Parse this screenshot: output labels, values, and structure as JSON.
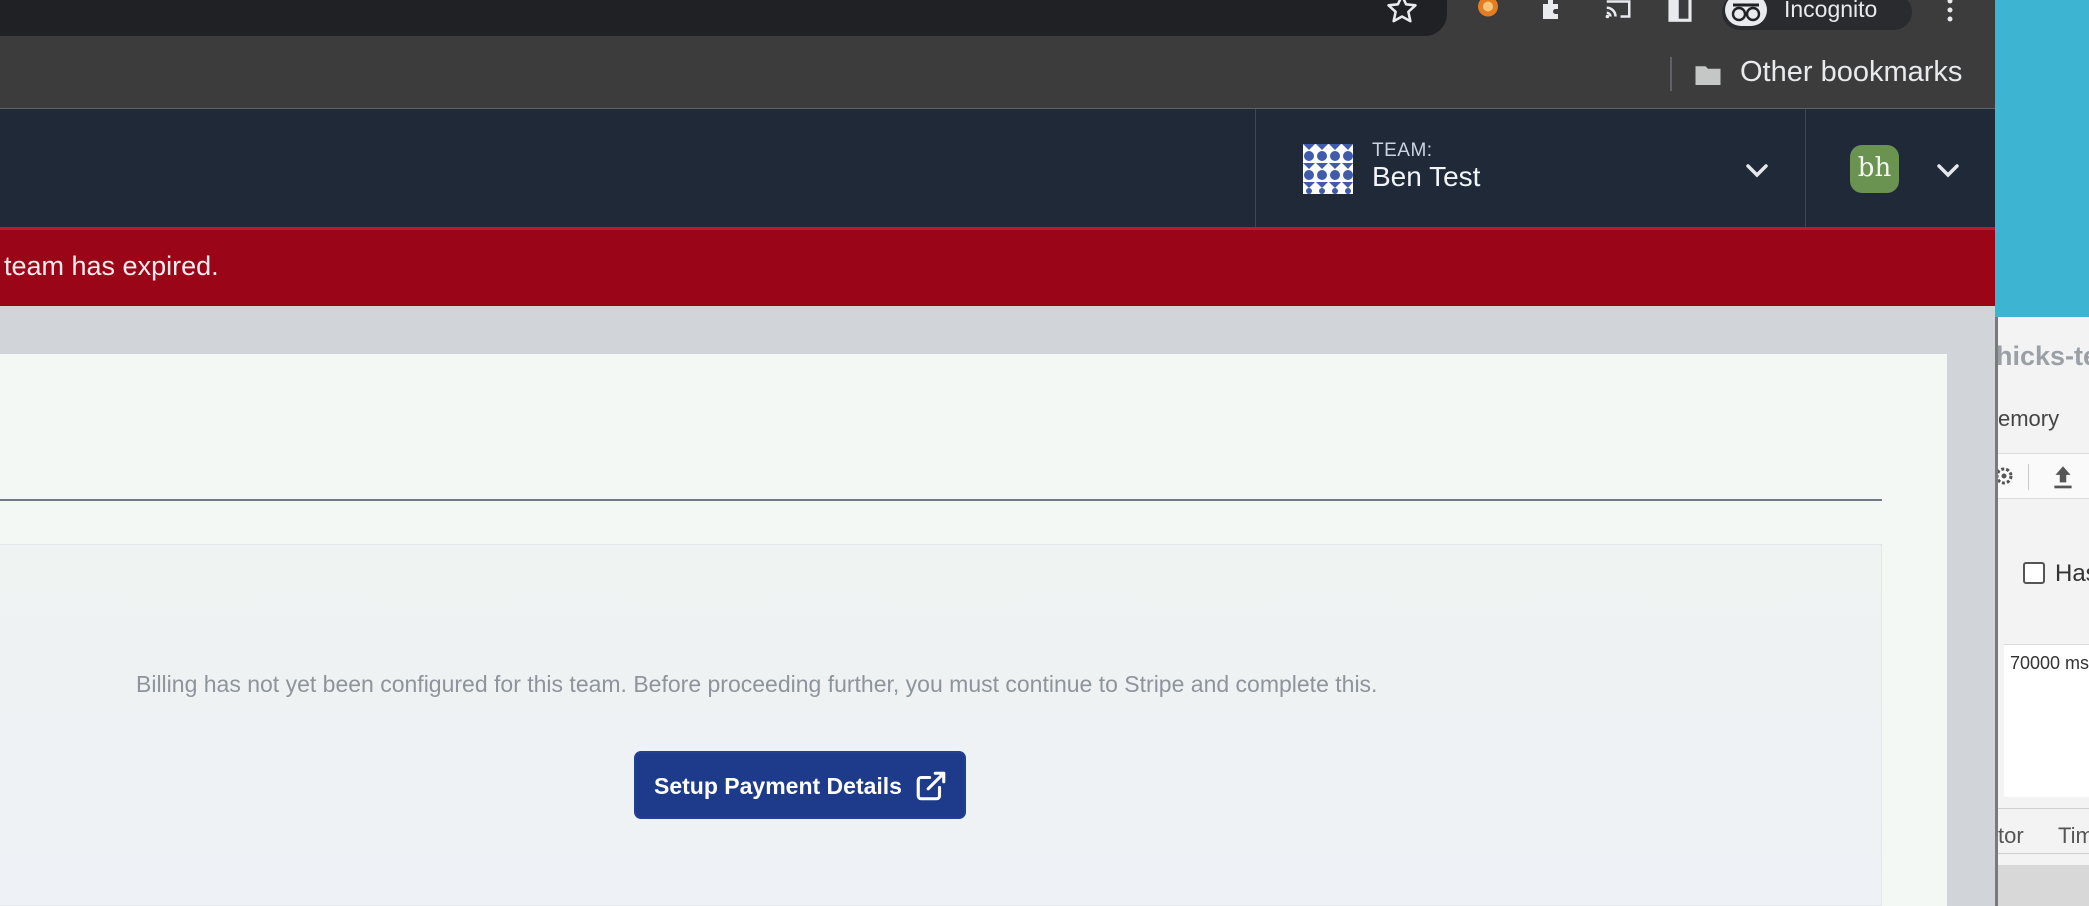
{
  "browser": {
    "profile_label": "Incognito",
    "bookmarks_folder": "Other bookmarks"
  },
  "header": {
    "team_label": "TEAM:",
    "team_name": "Ben Test",
    "user_initials": "bh"
  },
  "banner": {
    "message": "team has expired."
  },
  "billing": {
    "message": "Billing has not yet been configured for this team. Before proceeding further, you must continue to Stripe and complete this.",
    "button_label": "Setup Payment Details"
  },
  "background_window": {
    "title": "hicks-te",
    "memory_tab": "emory",
    "checkbox_label": "Has",
    "timeout_value": "70000 ms",
    "tab_left": "tor",
    "tab_right": "Tim"
  },
  "colors": {
    "header_bg": "#1f2937",
    "banner_bg": "#9a0617",
    "button_bg": "#1e3a8a",
    "avatar_bg": "#6a9250"
  }
}
